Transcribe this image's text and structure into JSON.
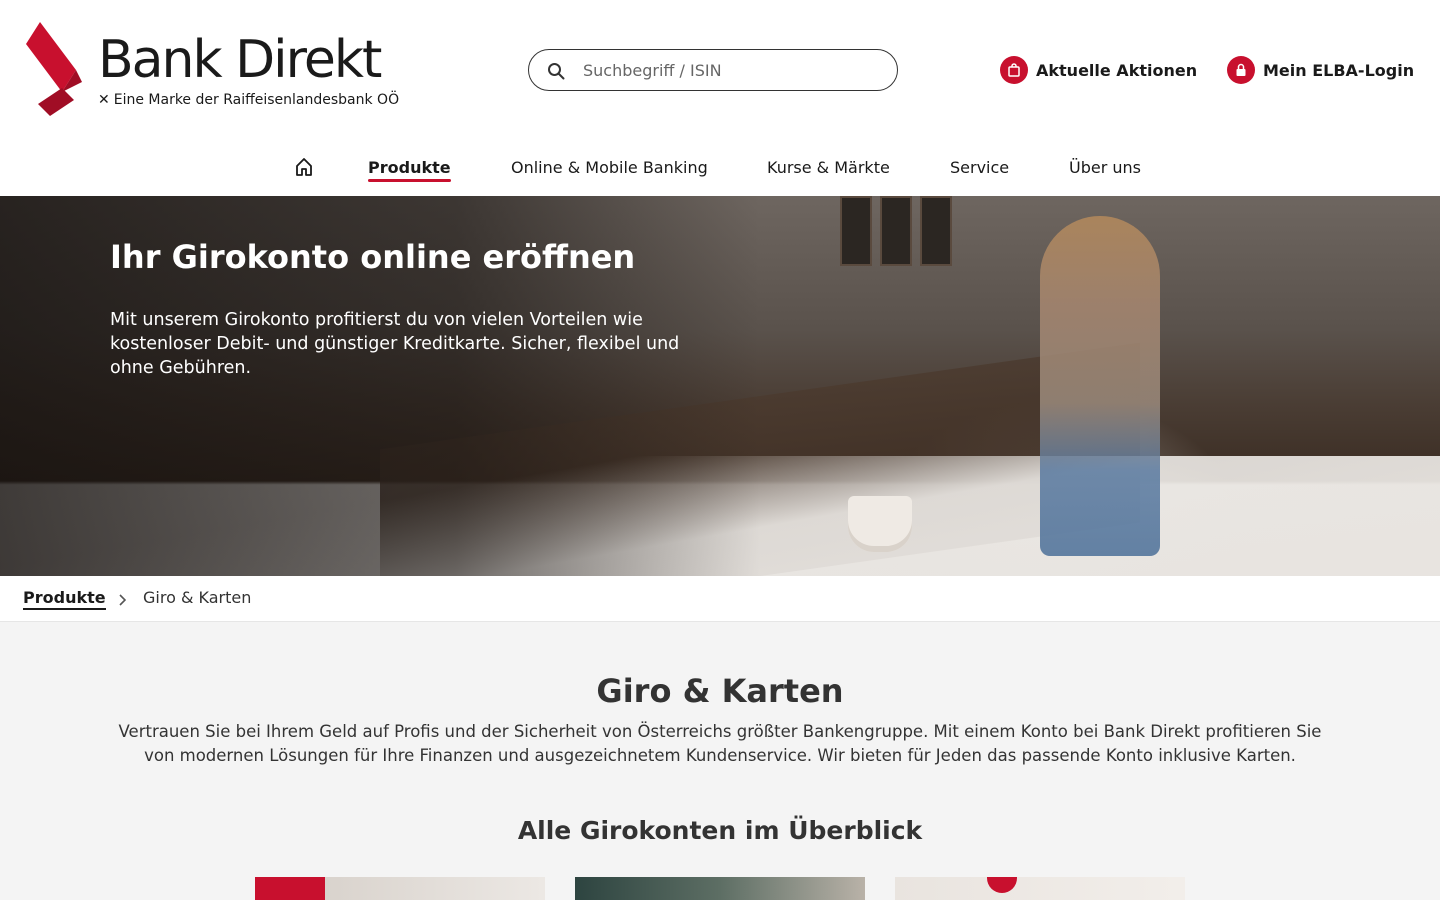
{
  "brand": {
    "name": "Bank Direkt",
    "tagline": "Eine Marke der Raiffeisenlandesbank OÖ",
    "tagline_mark": "✕",
    "accent_color": "#c8102e"
  },
  "search": {
    "placeholder": "Suchbegriff / ISIN",
    "value": "",
    "icon": "search-icon"
  },
  "header_links": [
    {
      "label": "Aktuelle Aktionen",
      "icon": "shopping-bag-icon"
    },
    {
      "label": "Mein ELBA-Login",
      "icon": "lock-icon"
    }
  ],
  "nav": {
    "home_icon": "home-icon",
    "items": [
      {
        "label": "Produkte",
        "active": true
      },
      {
        "label": "Online & Mobile Banking",
        "active": false
      },
      {
        "label": "Kurse & Märkte",
        "active": false
      },
      {
        "label": "Service",
        "active": false
      },
      {
        "label": "Über uns",
        "active": false
      }
    ]
  },
  "hero": {
    "title": "Ihr Girokonto online eröffnen",
    "text": "Mit unserem Girokonto profitierst du von vielen Vorteilen wie kostenloser Debit- und günstiger Kreditkarte. Sicher, flexibel und ohne Gebühren."
  },
  "breadcrumb": {
    "parent": "Produkte",
    "current": "Giro & Karten",
    "separator_icon": "chevron-right-icon"
  },
  "main": {
    "title": "Giro & Karten",
    "text": "Vertrauen Sie bei Ihrem Geld auf Profis und der Sicherheit von Österreichs größter Bankengruppe. Mit einem Konto bei Bank Direkt profitieren Sie von modernen Lösungen für Ihre Finanzen und ausgezeichnetem Kundenservice. Wir bieten für Jeden das passende Konto inklusive Karten.",
    "subtitle": "Alle Girokonten im Überblick"
  }
}
